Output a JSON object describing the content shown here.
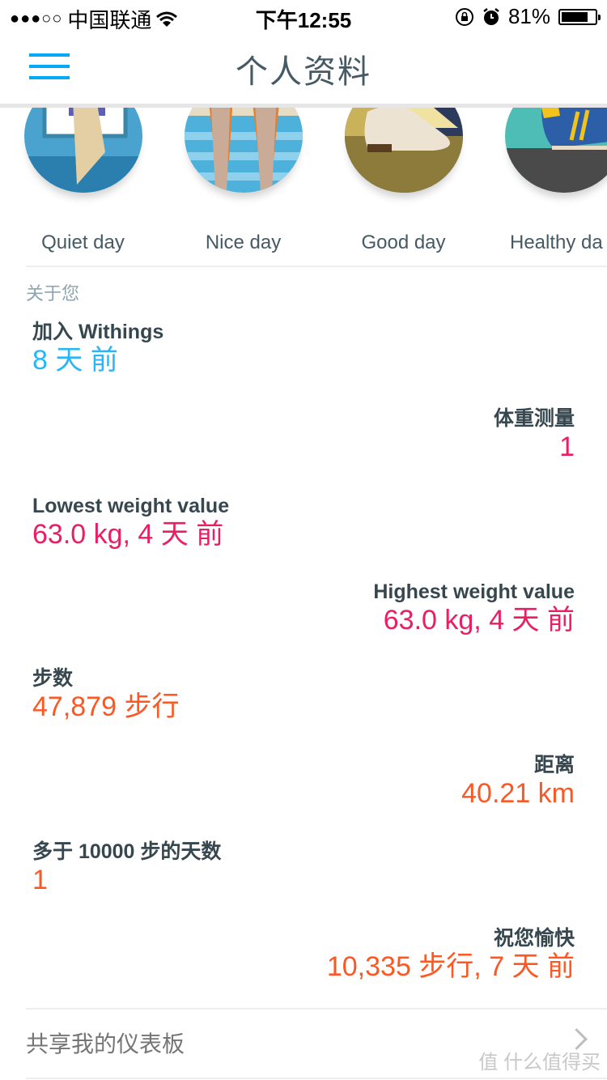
{
  "status_bar": {
    "signal": "●●●○○",
    "carrier": "中国联通",
    "time": "下午12:55",
    "battery_percent": "81%",
    "battery_level": 0.81,
    "icons": [
      "wifi-icon",
      "rotation-lock-icon",
      "alarm-icon",
      "battery-icon"
    ]
  },
  "nav": {
    "title": "个人资料",
    "menu_icon": "hamburger-menu-icon",
    "accent": "#03a9f4"
  },
  "day_badges": [
    {
      "label": "Quiet day"
    },
    {
      "label": "Nice day"
    },
    {
      "label": "Good day"
    },
    {
      "label": "Healthy da"
    }
  ],
  "about": {
    "title": "关于您",
    "stats": [
      {
        "label": "加入 Withings",
        "value": "8 天 前",
        "color": "#29b6f6",
        "align": "left"
      },
      {
        "label": "体重测量",
        "value": "1",
        "color": "#e91e63",
        "align": "right"
      },
      {
        "label": "Lowest weight value",
        "value": "63.0 kg, 4 天 前",
        "color": "#e91e63",
        "align": "left"
      },
      {
        "label": "Highest weight value",
        "value": "63.0 kg, 4 天 前",
        "color": "#e91e63",
        "align": "right"
      },
      {
        "label": "步数",
        "value": "47,879 步行",
        "color": "#ff5722",
        "align": "left"
      },
      {
        "label": "距离",
        "value": "40.21 km",
        "color": "#ff5722",
        "align": "right"
      },
      {
        "label": "多于 10000 步的天数",
        "value": "1",
        "color": "#ff5722",
        "align": "left"
      },
      {
        "label": "祝您愉快",
        "value": "10,335 步行, 7 天 前",
        "color": "#ff5722",
        "align": "right"
      }
    ]
  },
  "share": {
    "label": "共享我的仪表板",
    "chevron_icon": "chevron-right-icon"
  },
  "watermark": "值 什么值得买"
}
